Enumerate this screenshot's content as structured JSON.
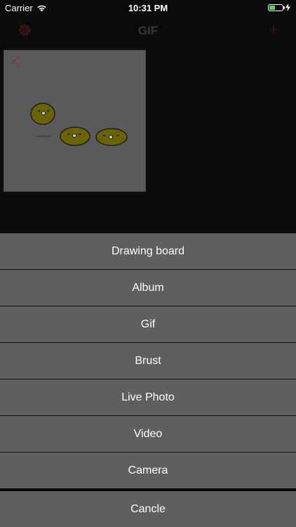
{
  "status_bar": {
    "carrier": "Carrier",
    "time": "10:31 PM",
    "battery_level": 0.45,
    "battery_color": "#4cd964"
  },
  "nav_bar": {
    "title": "GIF",
    "left_icon": "settings-gear-icon",
    "right_icon": "plus-icon",
    "accent_color": "#5a1a1a"
  },
  "content": {
    "items": [
      {
        "type": "gif",
        "share_icon": "share-icon"
      }
    ]
  },
  "action_sheet": {
    "options": [
      {
        "label": "Drawing board"
      },
      {
        "label": "Album"
      },
      {
        "label": "Gif"
      },
      {
        "label": "Brust"
      },
      {
        "label": "Live Photo"
      },
      {
        "label": "Video"
      },
      {
        "label": "Camera"
      }
    ],
    "cancel_label": "Cancle"
  }
}
